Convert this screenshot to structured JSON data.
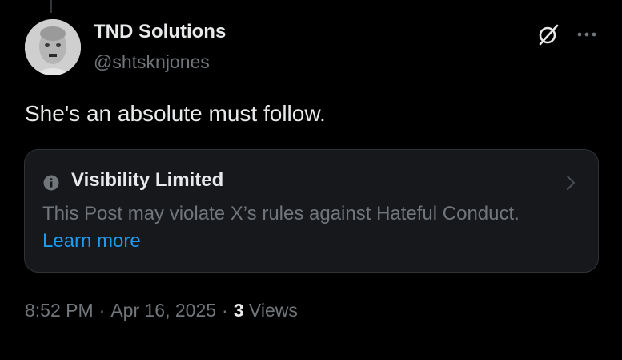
{
  "post": {
    "author": {
      "display_name": "TND Solutions",
      "handle": "@shtsknjones",
      "avatar": "avatar-photo"
    },
    "text": "She's an absolute must follow.",
    "icons": {
      "grok": "grok-icon",
      "more": "more-icon"
    },
    "notice": {
      "icon": "info-icon",
      "title": "Visibility Limited",
      "body": "This Post may violate X’s rules against Hateful Conduct.",
      "link": "Learn more",
      "chevron": "chevron-right-icon"
    },
    "meta": {
      "time": "8:52 PM",
      "separator": "·",
      "date": "Apr 16, 2025",
      "views_count": "3",
      "views_label": "Views"
    }
  },
  "colors": {
    "background": "#000000",
    "primary_text": "#e7e9ea",
    "secondary_text": "#71767b",
    "link": "#1d9bf0",
    "card_background": "#16181c",
    "border": "#2f3336"
  }
}
